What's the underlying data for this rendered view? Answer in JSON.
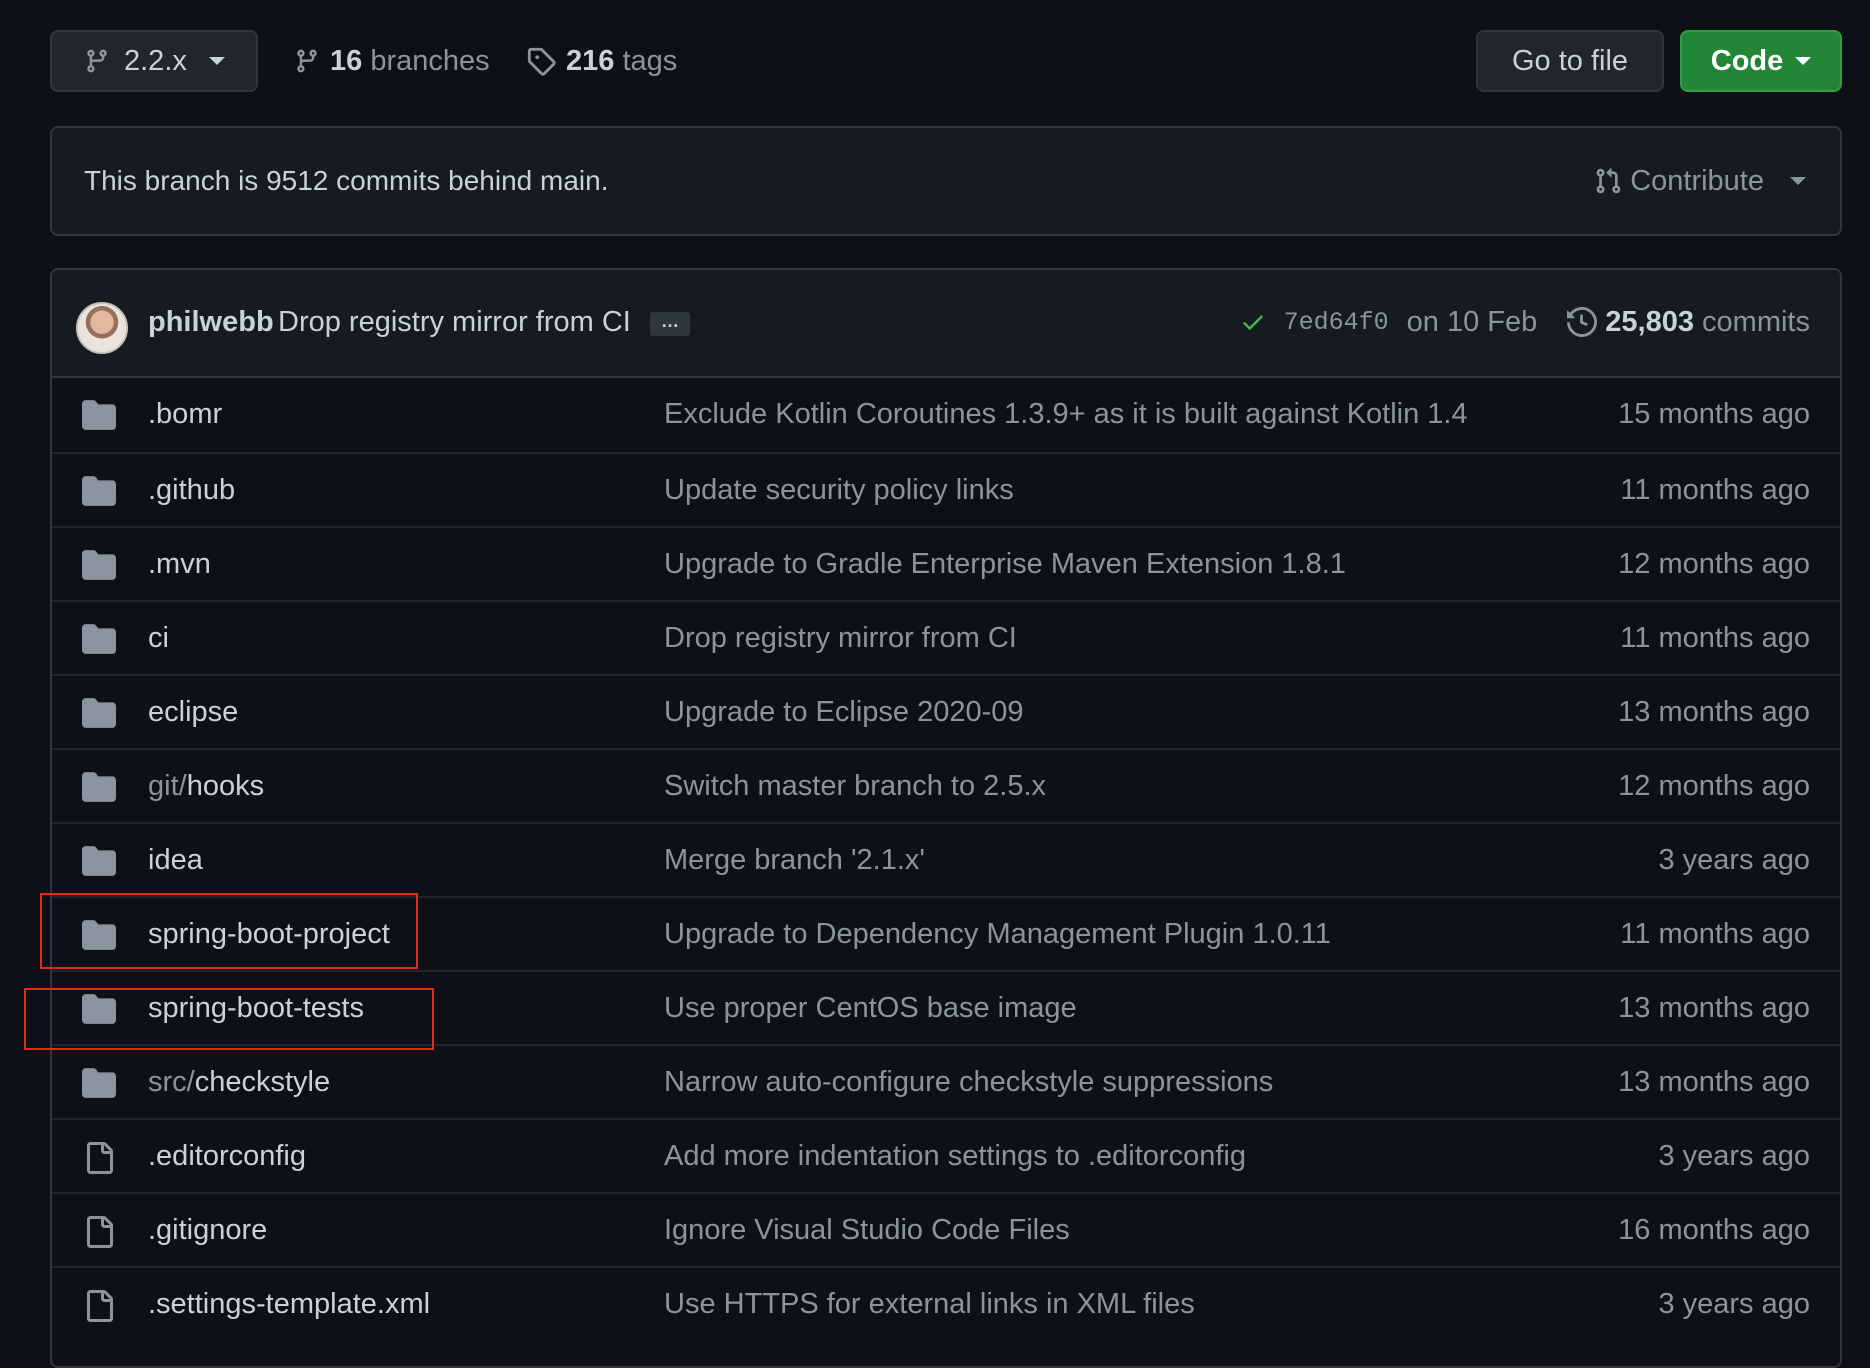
{
  "topbar": {
    "branch_label": "2.2.x",
    "branches_count": "16",
    "branches_label": "branches",
    "tags_count": "216",
    "tags_label": "tags",
    "goto_file_label": "Go to file",
    "code_label": "Code"
  },
  "notice": {
    "text": "This branch is 9512 commits behind main.",
    "contribute_label": "Contribute"
  },
  "latest_commit": {
    "author": "philwebb",
    "message": "Drop registry mirror from CI",
    "ellipsis": "…",
    "sha": "7ed64f0",
    "date": "on 10 Feb",
    "commits_count": "25,803",
    "commits_label": "commits",
    "status": "success"
  },
  "files": [
    {
      "type": "folder",
      "prefix": "",
      "name": ".bomr",
      "message": "Exclude Kotlin Coroutines 1.3.9+ as it is built against Kotlin 1.4",
      "age": "15 months ago"
    },
    {
      "type": "folder",
      "prefix": "",
      "name": ".github",
      "message": "Update security policy links",
      "age": "11 months ago"
    },
    {
      "type": "folder",
      "prefix": "",
      "name": ".mvn",
      "message": "Upgrade to Gradle Enterprise Maven Extension 1.8.1",
      "age": "12 months ago"
    },
    {
      "type": "folder",
      "prefix": "",
      "name": "ci",
      "message": "Drop registry mirror from CI",
      "age": "11 months ago"
    },
    {
      "type": "folder",
      "prefix": "",
      "name": "eclipse",
      "message": "Upgrade to Eclipse 2020-09",
      "age": "13 months ago"
    },
    {
      "type": "folder",
      "prefix": "git/",
      "name": "hooks",
      "message": "Switch master branch to 2.5.x",
      "age": "12 months ago"
    },
    {
      "type": "folder",
      "prefix": "",
      "name": "idea",
      "message": "Merge branch '2.1.x'",
      "age": "3 years ago"
    },
    {
      "type": "folder",
      "prefix": "",
      "name": "spring-boot-project",
      "message": "Upgrade to Dependency Management Plugin 1.0.11",
      "age": "11 months ago"
    },
    {
      "type": "folder",
      "prefix": "",
      "name": "spring-boot-tests",
      "message": "Use proper CentOS base image",
      "age": "13 months ago"
    },
    {
      "type": "folder",
      "prefix": "src/",
      "name": "checkstyle",
      "message": "Narrow auto-configure checkstyle suppressions",
      "age": "13 months ago"
    },
    {
      "type": "file",
      "prefix": "",
      "name": ".editorconfig",
      "message": "Add more indentation settings to .editorconfig",
      "age": "3 years ago"
    },
    {
      "type": "file",
      "prefix": "",
      "name": ".gitignore",
      "message": "Ignore Visual Studio Code Files",
      "age": "16 months ago"
    },
    {
      "type": "file",
      "prefix": "",
      "name": ".settings-template.xml",
      "message": "Use HTTPS for external links in XML files",
      "age": "3 years ago"
    }
  ],
  "colors": {
    "background": "#0d1117",
    "code_button": "#238636",
    "success_check": "#3fb950",
    "highlight": "#e5281b"
  }
}
